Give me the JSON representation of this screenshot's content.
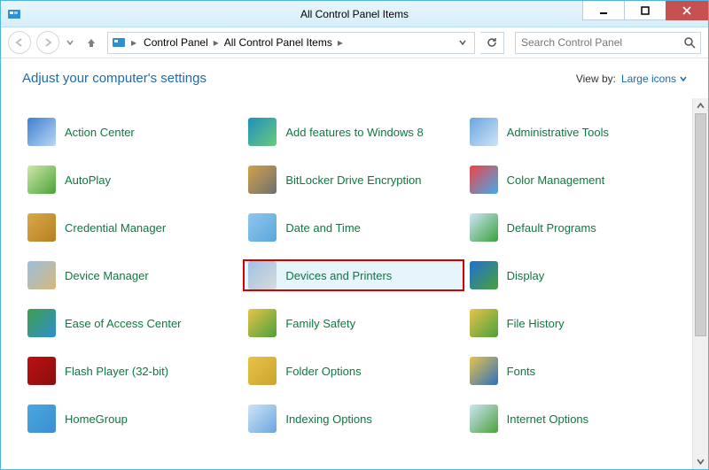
{
  "window": {
    "title": "All Control Panel Items"
  },
  "breadcrumbs": {
    "root": "Control Panel",
    "current": "All Control Panel Items"
  },
  "search": {
    "placeholder": "Search Control Panel"
  },
  "header": {
    "heading": "Adjust your computer's settings",
    "viewby_label": "View by:",
    "viewby_value": "Large icons"
  },
  "items": [
    {
      "label": "Action Center",
      "icon": "flag-icon",
      "c1": "#3f7fd1",
      "c2": "#b9d7f4",
      "hl": false
    },
    {
      "label": "Add features to Windows 8",
      "icon": "monitor-plus-icon",
      "c1": "#1f8fbf",
      "c2": "#6acb7a",
      "hl": false
    },
    {
      "label": "Administrative Tools",
      "icon": "tools-icon",
      "c1": "#6aa5de",
      "c2": "#cfe4f7",
      "hl": false
    },
    {
      "label": "AutoPlay",
      "icon": "autoplay-icon",
      "c1": "#cfe8a7",
      "c2": "#4aa23a",
      "hl": false
    },
    {
      "label": "BitLocker Drive Encryption",
      "icon": "bitlocker-icon",
      "c1": "#d0a24a",
      "c2": "#6f6f6f",
      "hl": false
    },
    {
      "label": "Color Management",
      "icon": "color-icon",
      "c1": "#e44",
      "c2": "#4ae",
      "hl": false
    },
    {
      "label": "Credential Manager",
      "icon": "vault-icon",
      "c1": "#d8a94a",
      "c2": "#b77f22",
      "hl": false
    },
    {
      "label": "Date and Time",
      "icon": "clock-icon",
      "c1": "#8fc6ee",
      "c2": "#5aa7d9",
      "hl": false
    },
    {
      "label": "Default Programs",
      "icon": "defaults-icon",
      "c1": "#cfe4f7",
      "c2": "#3aa23a",
      "hl": false
    },
    {
      "label": "Device Manager",
      "icon": "device-manager-icon",
      "c1": "#9bbfe0",
      "c2": "#d7b879",
      "hl": false
    },
    {
      "label": "Devices and Printers",
      "icon": "printer-icon",
      "c1": "#9ec3e6",
      "c2": "#dadada",
      "hl": true
    },
    {
      "label": "Display",
      "icon": "display-icon",
      "c1": "#1f6fd1",
      "c2": "#4aa23a",
      "hl": false
    },
    {
      "label": "Ease of Access Center",
      "icon": "ease-access-icon",
      "c1": "#3f9f4a",
      "c2": "#2f8fd1",
      "hl": false
    },
    {
      "label": "Family Safety",
      "icon": "family-safety-icon",
      "c1": "#e7c34a",
      "c2": "#4aa23a",
      "hl": false
    },
    {
      "label": "File History",
      "icon": "file-history-icon",
      "c1": "#e7c34a",
      "c2": "#4aa23a",
      "hl": false
    },
    {
      "label": "Flash Player (32-bit)",
      "icon": "flash-icon",
      "c1": "#b11",
      "c2": "#8a0e0e",
      "hl": false
    },
    {
      "label": "Folder Options",
      "icon": "folder-options-icon",
      "c1": "#e7c34a",
      "c2": "#caa42c",
      "hl": false
    },
    {
      "label": "Fonts",
      "icon": "fonts-icon",
      "c1": "#e7c34a",
      "c2": "#2f6fbf",
      "hl": false
    },
    {
      "label": "HomeGroup",
      "icon": "homegroup-icon",
      "c1": "#4aa7e0",
      "c2": "#3a8fd0",
      "hl": false
    },
    {
      "label": "Indexing Options",
      "icon": "indexing-icon",
      "c1": "#cfe4f7",
      "c2": "#6aa5de",
      "hl": false
    },
    {
      "label": "Internet Options",
      "icon": "internet-options-icon",
      "c1": "#cfe4f7",
      "c2": "#4aa23a",
      "hl": false
    }
  ]
}
